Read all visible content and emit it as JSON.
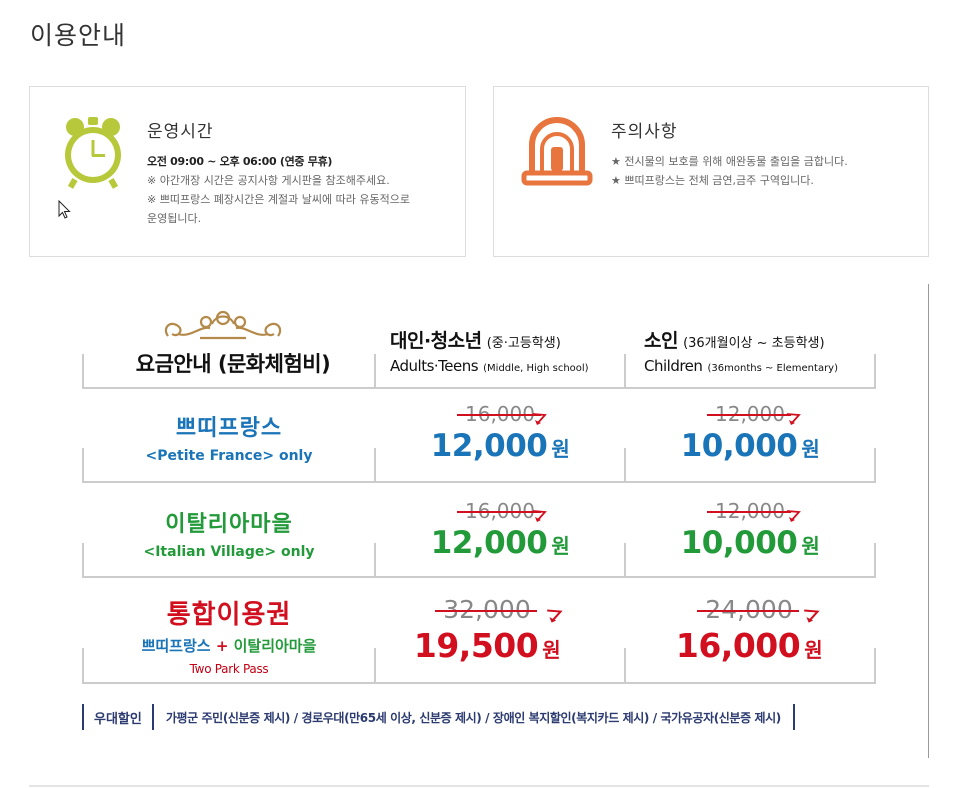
{
  "page": {
    "title": "이용안내"
  },
  "hours": {
    "title": "운영시간",
    "line1": "오전 09:00 ~ 오후 06:00 (연중 무휴)",
    "line2": "※ 야간개장 시간은 공지사항 게시판을 참조해주세요.",
    "line3": "※ 쁘띠프랑스 폐장시간은 계절과 날씨에 따라 유동적으로",
    "line4": "운영됩니다.",
    "icon": "alarm-clock-icon",
    "icon_color": "#b7c93a"
  },
  "notice": {
    "title": "주의사항",
    "line1": "★ 전시물의 보호를 위해 애완동물 출입을 금합니다.",
    "line2": "★ 쁘띠프랑스는 전체 금연,금주 구역입니다.",
    "icon": "siren-icon",
    "icon_color": "#e8743e"
  },
  "fee": {
    "title": "요금안내 (문화체험비)",
    "col_adult_ko": "대인·청소년",
    "col_adult_ko_sub": "(중·고등학생)",
    "col_adult_en": "Adults·Teens",
    "col_adult_en_sub": "(Middle, High school)",
    "col_child_ko": "소인",
    "col_child_ko_sub": "(36개월이상 ~ 초등학생)",
    "col_child_en": "Children",
    "col_child_en_sub": "(36months ~ Elementary)",
    "rows": [
      {
        "name_ko": "쁘띠프랑스",
        "name_en": "<Petite France> only",
        "adult_old": "16,000",
        "adult_new": "12,000",
        "child_old": "12,000",
        "child_new": "10,000",
        "won": "원"
      },
      {
        "name_ko": "이탈리아마을",
        "name_en": "<Italian Village> only",
        "adult_old": "16,000",
        "adult_new": "12,000",
        "child_old": "12,000",
        "child_new": "10,000",
        "won": "원"
      },
      {
        "name_ko": "통합이용권",
        "combo_a": "쁘띠프랑스",
        "combo_plus": " + ",
        "combo_b": "이탈리아마을",
        "name_en": "Two Park Pass",
        "adult_old": "32,000",
        "adult_new": "19,500",
        "child_old": "24,000",
        "child_new": "16,000",
        "won": "원"
      }
    ],
    "colors": {
      "blue": "#1a74b8",
      "green": "#229a3a",
      "red": "#d10f1e"
    }
  },
  "discount": {
    "label": "우대할인",
    "text": "가평군 주민(신분증 제시) / 경로우대(만65세 이상, 신분증 제시) / 장애인 복지할인(복지카드 제시) / 국가유공자(신분증 제시)"
  }
}
